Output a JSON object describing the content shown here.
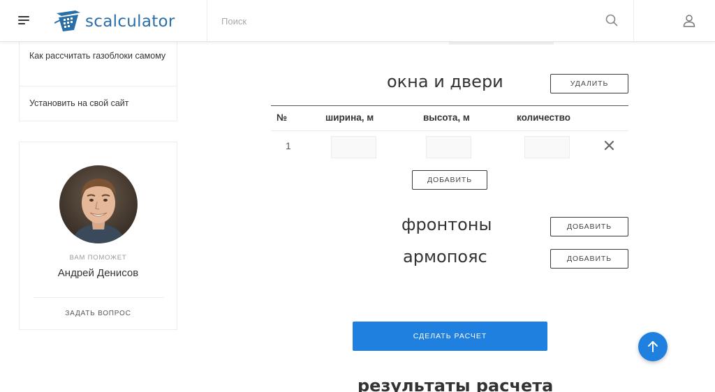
{
  "header": {
    "logo_text": "scalculator",
    "search_placeholder": "Поиск"
  },
  "sidebar": {
    "menu_items": [
      {
        "label": "Как рассчитать газоблоки самому"
      },
      {
        "label": "Установить на свой сайт"
      }
    ],
    "helper": {
      "caption": "ВАМ ПОМОЖЕТ",
      "name": "Андрей Денисов",
      "ask_label": "ЗАДАТЬ ВОПРОС"
    }
  },
  "windows_doors": {
    "title": "окна и двери",
    "delete_label": "УДАЛИТЬ",
    "columns": [
      "№",
      "ширина, м",
      "высота, м",
      "количество"
    ],
    "rows": [
      {
        "num": "1",
        "width": "",
        "height": "",
        "quantity": ""
      }
    ],
    "add_label": "ДОБАВИТЬ"
  },
  "gables": {
    "title": "фронтоны",
    "add_label": "ДОБАВИТЬ"
  },
  "armopoyas": {
    "title": "армопояс",
    "add_label": "ДОБАВИТЬ"
  },
  "calculate_label": "СДЕЛАТЬ РАСЧЕТ",
  "results_title": "результаты расчета",
  "colors": {
    "accent": "#2080e0",
    "logo": "#2b6fa8",
    "text": "#333333"
  }
}
